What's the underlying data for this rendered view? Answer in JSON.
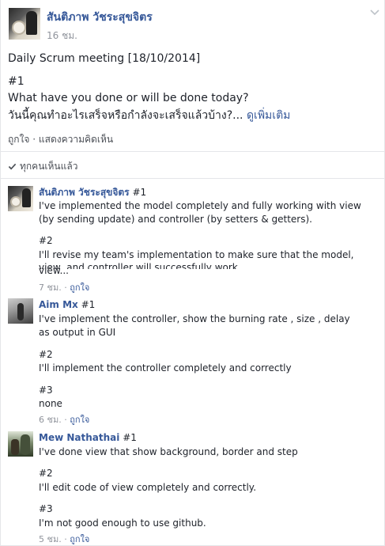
{
  "post": {
    "author": "สันติภาพ วัชระสุขจิตร",
    "time": "16 ชม.",
    "lines": [
      "Daily Scrum meeting [18/10/2014]",
      "#1",
      "What have you done or will be done today?",
      "วันนี้คุณทำอะไรเสร็จหรือกำลังจะเสร็จแล้วบ้าง?..."
    ],
    "see_more": "ดูเพิ่มเติม",
    "like": "ถูกใจ",
    "separator": "·",
    "comment": "แสดงความคิดเห็น",
    "seen": "ทุกคนเห็นแล้ว"
  },
  "comments": [
    {
      "name": "สันติภาพ วัชระสุขจิตร",
      "lines": [
        "#1",
        "I've implemented the model completely and fully working with view",
        "(by sending update) and controller (by setters & getters).",
        "#2",
        "I'll revise my team's implementation to make sure that the model,",
        "view, and controller will successfully work",
        "view..."
      ],
      "time": "7 ชม.",
      "like": "ถูกใจ"
    },
    {
      "name": "Aim Mx",
      "lines": [
        "#1",
        "I've implement the controller, show the burning rate , size , delay",
        "as output in GUI",
        "#2",
        "I'll implement the controller completely and correctly",
        "#3",
        "none"
      ],
      "time": "6 ชม.",
      "like": "ถูกใจ"
    },
    {
      "name": "Mew Nathathai",
      "lines": [
        "#1",
        "I've done view that show background, border and step",
        "#2",
        "I'll edit code of view completely and correctly.",
        "#3",
        "I'm not good enough to use github."
      ],
      "time": "5 ชม.",
      "like": "ถูกใจ"
    }
  ],
  "colors": {
    "link": "#365899",
    "text": "#1d2129",
    "meta": "#90949c"
  },
  "icons": [
    "chevron-down-icon",
    "check-icon"
  ]
}
